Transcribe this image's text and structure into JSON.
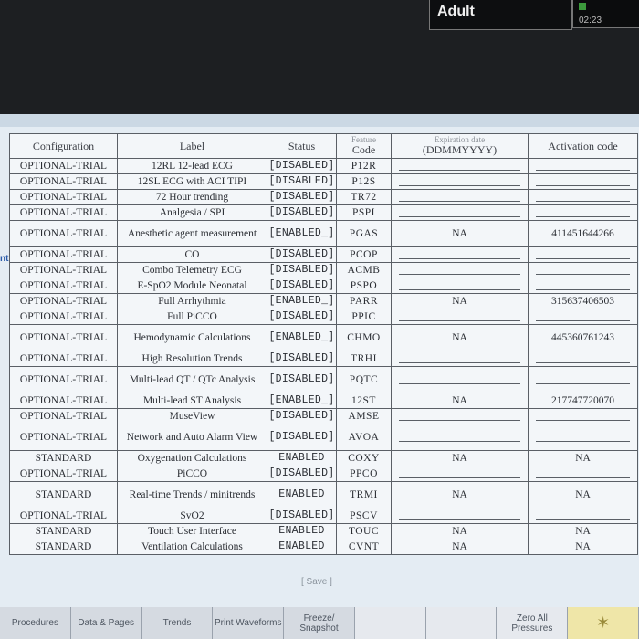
{
  "header": {
    "patient_type": "Adult",
    "clock": "02:23"
  },
  "side_text": "nt",
  "table": {
    "headers": {
      "configuration": "Configuration",
      "label": "Label",
      "status": "Status",
      "feature_code_top": "Feature",
      "feature_code": "Code",
      "expiration_top": "Expiration date",
      "expiration": "(DDMMYYYY)",
      "activation": "Activation code"
    },
    "rows": [
      {
        "config": "OPTIONAL-TRIAL",
        "label": "12RL 12-lead ECG",
        "status": "[DISABLED]",
        "code": "P12R",
        "expiration": "",
        "activation": ""
      },
      {
        "config": "OPTIONAL-TRIAL",
        "label": "12SL ECG with ACI TIPI",
        "status": "[DISABLED]",
        "code": "P12S",
        "expiration": "",
        "activation": ""
      },
      {
        "config": "OPTIONAL-TRIAL",
        "label": "72 Hour trending",
        "status": "[DISABLED]",
        "code": "TR72",
        "expiration": "",
        "activation": ""
      },
      {
        "config": "OPTIONAL-TRIAL",
        "label": "Analgesia / SPI",
        "status": "[DISABLED]",
        "code": "PSPI",
        "expiration": "",
        "activation": ""
      },
      {
        "config": "OPTIONAL-TRIAL",
        "label": "Anesthetic agent measurement",
        "status": "[ENABLED_]",
        "code": "PGAS",
        "expiration": "NA",
        "activation": "411451644266"
      },
      {
        "config": "OPTIONAL-TRIAL",
        "label": "CO",
        "status": "[DISABLED]",
        "code": "PCOP",
        "expiration": "",
        "activation": ""
      },
      {
        "config": "OPTIONAL-TRIAL",
        "label": "Combo Telemetry ECG",
        "status": "[DISABLED]",
        "code": "ACMB",
        "expiration": "",
        "activation": ""
      },
      {
        "config": "OPTIONAL-TRIAL",
        "label": "E-SpO2 Module Neonatal",
        "status": "[DISABLED]",
        "code": "PSPO",
        "expiration": "",
        "activation": ""
      },
      {
        "config": "OPTIONAL-TRIAL",
        "label": "Full Arrhythmia",
        "status": "[ENABLED_]",
        "code": "PARR",
        "expiration": "NA",
        "activation": "315637406503"
      },
      {
        "config": "OPTIONAL-TRIAL",
        "label": "Full PiCCO",
        "status": "[DISABLED]",
        "code": "PPIC",
        "expiration": "",
        "activation": ""
      },
      {
        "config": "OPTIONAL-TRIAL",
        "label": "Hemodynamic Calculations",
        "status": "[ENABLED_]",
        "code": "CHMO",
        "expiration": "NA",
        "activation": "445360761243"
      },
      {
        "config": "OPTIONAL-TRIAL",
        "label": "High Resolution Trends",
        "status": "[DISABLED]",
        "code": "TRHI",
        "expiration": "",
        "activation": ""
      },
      {
        "config": "OPTIONAL-TRIAL",
        "label": "Multi-lead QT / QTc Analysis",
        "status": "[DISABLED]",
        "code": "PQTC",
        "expiration": "",
        "activation": ""
      },
      {
        "config": "OPTIONAL-TRIAL",
        "label": "Multi-lead ST Analysis",
        "status": "[ENABLED_]",
        "code": "12ST",
        "expiration": "NA",
        "activation": "217747720070"
      },
      {
        "config": "OPTIONAL-TRIAL",
        "label": "MuseView",
        "status": "[DISABLED]",
        "code": "AMSE",
        "expiration": "",
        "activation": ""
      },
      {
        "config": "OPTIONAL-TRIAL",
        "label": "Network and Auto Alarm View",
        "status": "[DISABLED]",
        "code": "AVOA",
        "expiration": "",
        "activation": ""
      },
      {
        "config": "STANDARD",
        "label": "Oxygenation Calculations",
        "status": "ENABLED",
        "code": "COXY",
        "expiration": "NA",
        "activation": "NA"
      },
      {
        "config": "OPTIONAL-TRIAL",
        "label": "PiCCO",
        "status": "[DISABLED]",
        "code": "PPCO",
        "expiration": "",
        "activation": ""
      },
      {
        "config": "STANDARD",
        "label": "Real-time Trends / minitrends",
        "status": "ENABLED",
        "code": "TRMI",
        "expiration": "NA",
        "activation": "NA"
      },
      {
        "config": "OPTIONAL-TRIAL",
        "label": "SvO2",
        "status": "[DISABLED]",
        "code": "PSCV",
        "expiration": "",
        "activation": ""
      },
      {
        "config": "STANDARD",
        "label": "Touch User Interface",
        "status": "ENABLED",
        "code": "TOUC",
        "expiration": "NA",
        "activation": "NA"
      },
      {
        "config": "STANDARD",
        "label": "Ventilation Calculations",
        "status": "ENABLED",
        "code": "CVNT",
        "expiration": "NA",
        "activation": "NA"
      }
    ]
  },
  "save_label": "[ Save ]",
  "buttons": [
    {
      "name": "procedures",
      "label": "Procedures"
    },
    {
      "name": "data-pages",
      "label": "Data & Pages"
    },
    {
      "name": "trends",
      "label": "Trends"
    },
    {
      "name": "print-waveforms",
      "label": "Print Waveforms"
    },
    {
      "name": "freeze-snapshot",
      "label": "Freeze/ Snapshot"
    },
    {
      "name": "blank-1",
      "label": ""
    },
    {
      "name": "blank-2",
      "label": ""
    },
    {
      "name": "zero-all-pressures",
      "label": "Zero All Pressures"
    },
    {
      "name": "alarm-silence",
      "label": "",
      "icon": "bell-icon"
    }
  ]
}
